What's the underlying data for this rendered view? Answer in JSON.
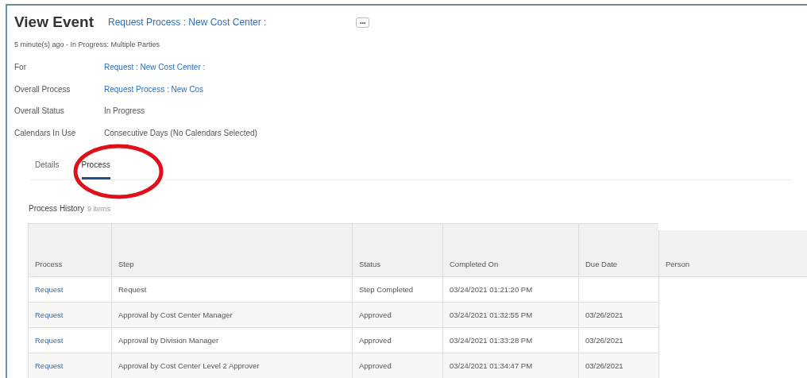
{
  "header": {
    "title": "View Event",
    "event_link": "Request Process : New Cost Center :",
    "more_button": "•••"
  },
  "subtitle": "5 minute(s) ago - In Progress: Multiple Parties",
  "fields": [
    {
      "label": "For",
      "value": "Request : New Cost Center :",
      "kind": "link"
    },
    {
      "label": "Overall Process",
      "value": "Request Process : New Cos",
      "kind": "link"
    },
    {
      "label": "Overall Status",
      "value": "In Progress",
      "kind": "text"
    },
    {
      "label": "Calendars In Use",
      "value": "Consecutive Days (No Calendars Selected)",
      "kind": "text"
    }
  ],
  "tabs": [
    {
      "label": "Details",
      "selected": false
    },
    {
      "label": "Process",
      "selected": true
    }
  ],
  "table": {
    "title": "Process History",
    "count": "9 items",
    "columns": [
      "Process",
      "Step",
      "Status",
      "Completed On",
      "Due Date",
      "Person"
    ],
    "rows": [
      {
        "process": "Request",
        "step": "Request",
        "status": "Step Completed",
        "completed_on": "03/24/2021 01:21:20 PM",
        "due_date": ""
      },
      {
        "process": "Request",
        "step": "Approval by Cost Center Manager",
        "status": "Approved",
        "completed_on": "03/24/2021 01:32:55 PM",
        "due_date": "03/26/2021"
      },
      {
        "process": "Request",
        "step": "Approval by Division Manager",
        "status": "Approved",
        "completed_on": "03/24/2021 01:33:28 PM",
        "due_date": "03/26/2021"
      },
      {
        "process": "Request",
        "step": "Approval by Cost Center Level 2 Approver",
        "status": "Approved",
        "completed_on": "03/24/2021 01:34:47 PM",
        "due_date": "03/26/2021"
      }
    ]
  }
}
